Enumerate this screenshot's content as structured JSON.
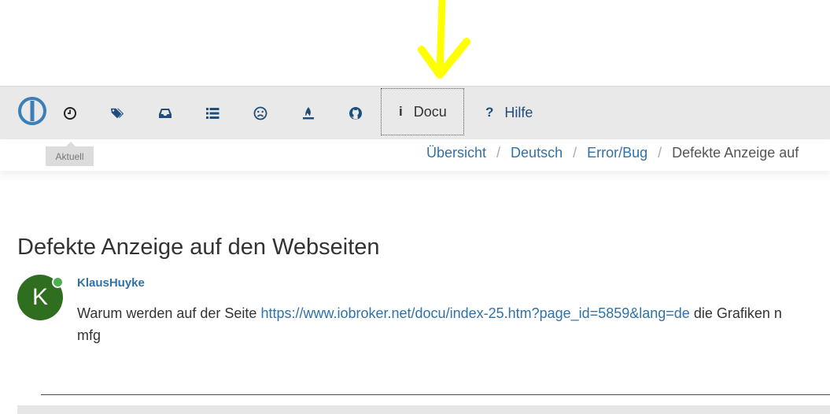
{
  "navbar": {
    "icons": [
      "clock-icon",
      "tags-icon",
      "inbox-icon",
      "list-icon",
      "frown-icon",
      "fire-icon",
      "github-icon"
    ],
    "tooltip": "Aktuell",
    "docu": {
      "symbol": "i",
      "label": "Docu"
    },
    "hilfe": {
      "symbol": "?",
      "label": "Hilfe"
    }
  },
  "breadcrumb": {
    "items": [
      "Übersicht",
      "Deutsch",
      "Error/Bug"
    ],
    "current": "Defekte Anzeige auf",
    "separator": "/"
  },
  "topic": {
    "title": "Defekte Anzeige auf den Webseiten",
    "author": "KlausHuyke",
    "avatar_letter": "K",
    "text_before": "Warum werden auf der Seite ",
    "link": "https://www.iobroker.net/docu/index-25.htm?page_id=5859&lang=de",
    "text_after": " die Grafiken n",
    "signature": "mfg"
  },
  "colors": {
    "annotation_arrow": "#ffff00",
    "link": "#2f72a8",
    "avatar": "#2f6e1f",
    "online": "#4caf50"
  }
}
